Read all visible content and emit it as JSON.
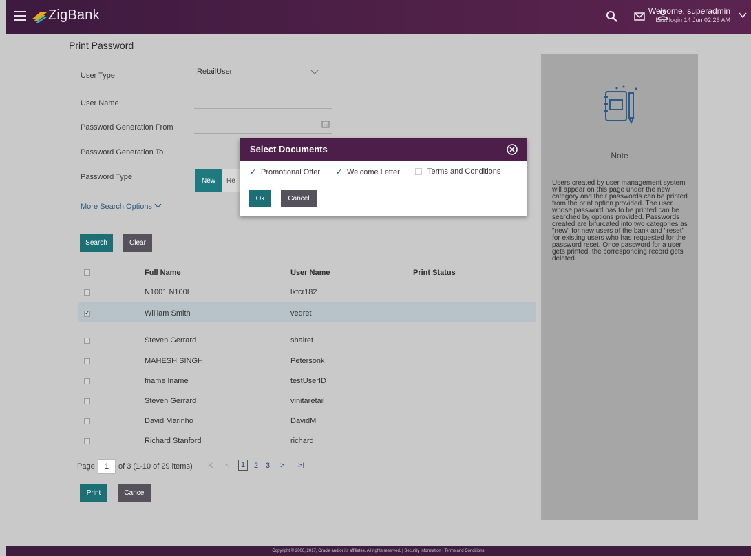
{
  "header": {
    "brand": "ZigBank",
    "welcome": "Welcome, superadmin",
    "last_login": "Last login 14 Jun 02:26 AM"
  },
  "page": {
    "title": "Print Password"
  },
  "form": {
    "user_type_label": "User Type",
    "user_type_value": "RetailUser",
    "user_name_label": "User Name",
    "user_name_value": "",
    "pw_from_label": "Password Generation From",
    "pw_to_label": "Password Generation To",
    "pw_type_label": "Password Type",
    "pw_type_options": [
      "New",
      "Re"
    ],
    "more_options": "More Search Options",
    "search_label": "Search",
    "clear_label": "Clear"
  },
  "table": {
    "headers": [
      "Full Name",
      "User Name",
      "Print Status"
    ],
    "rows": [
      {
        "full_name": "N1001 N100L",
        "user_name": "lkfcr182",
        "checked": false
      },
      {
        "full_name": "William Smith",
        "user_name": "vedret",
        "checked": true
      },
      {
        "full_name": "Steven Gerrard",
        "user_name": "shalret",
        "checked": false
      },
      {
        "full_name": "MAHESH SINGH",
        "user_name": "Petersonk",
        "checked": false
      },
      {
        "full_name": "fname lname",
        "user_name": "testUserID",
        "checked": false
      },
      {
        "full_name": "Steven Gerrard",
        "user_name": "vinitaretail",
        "checked": false
      },
      {
        "full_name": "David Marinho",
        "user_name": "DavidM",
        "checked": false
      },
      {
        "full_name": "Richard Stanford",
        "user_name": "richard",
        "checked": false
      }
    ]
  },
  "pagination": {
    "page_label": "Page",
    "page_value": "1",
    "of_text": "of 3  (1-10 of 29 items)",
    "first": "K",
    "prev": "<",
    "pages": [
      "1",
      "2",
      "3"
    ],
    "next": ">",
    "last": ">I"
  },
  "actions": {
    "print_label": "Print",
    "cancel_label": "Cancel"
  },
  "note": {
    "title": "Note",
    "text": "Users created by user management system will appear on this page under the new category and their passwords can be printed from the print option provided. The user whose password has to be printed can be searched by options provided. Passwords created are bifurcated into two categories as \"new\" for new users of the bank and \"reset\" for existing users who has requested for the password reset. Once password for a user gets printed, the corresponding record gets deleted."
  },
  "modal": {
    "title": "Select Documents",
    "options": [
      {
        "label": "Promotional Offer",
        "checked": true
      },
      {
        "label": "Welcome Letter",
        "checked": true
      },
      {
        "label": "Terms and Conditions",
        "checked": false
      }
    ],
    "ok_label": "Ok",
    "cancel_label": "Cancel"
  },
  "footer": {
    "text": "Copyright © 2006, 2017, Oracle and/or its affiliates. All rights reserved. | Security Information | Terms and Conditions"
  },
  "colors": {
    "header": "#4f2048",
    "modal_header": "#4d1e4a",
    "primary_button": "#1d6f76",
    "secondary_button": "#56525c",
    "footer": "#3e1d3f"
  }
}
